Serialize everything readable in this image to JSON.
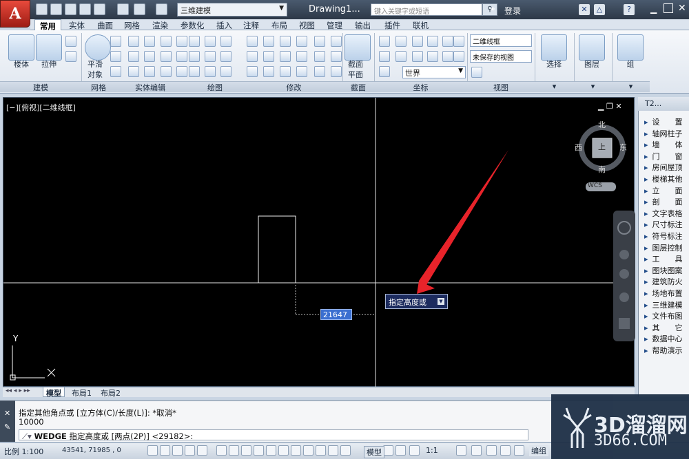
{
  "title_bar": {
    "workspace": "三维建模",
    "document_title": "Drawing1...",
    "search_placeholder": "键入关键字或短语",
    "login": "登录"
  },
  "ribbon_tabs": [
    "常用",
    "实体",
    "曲面",
    "网格",
    "渲染",
    "参数化",
    "插入",
    "注释",
    "布局",
    "视图",
    "管理",
    "输出",
    "插件",
    "联机"
  ],
  "active_tab": "常用",
  "ribbon": {
    "modeling_big": [
      "楼体",
      "拉伸"
    ],
    "smooth_label_1": "平滑",
    "smooth_label_2": "对象",
    "section_label_1": "截面",
    "section_label_2": "平面",
    "visual_style": "二维线框",
    "saved_view": "未保存的视图",
    "coord_world": "世界",
    "select_label": "选择",
    "layer_label": "图层",
    "group_label": "组",
    "groups": [
      "建模",
      "网格",
      "实体编辑",
      "绘图",
      "修改",
      "截面",
      "坐标",
      "视图"
    ]
  },
  "viewport": {
    "label": "[−][俯视][二维线框]",
    "compass": {
      "north": "北",
      "south": "南",
      "east": "东",
      "west": "西",
      "center": "上"
    },
    "wcs": "WCS",
    "tooltip": "指定高度或",
    "dim_value": "21647",
    "ucs_x": "X",
    "ucs_y": "Y"
  },
  "layout_tabs": [
    "模型",
    "布局1",
    "布局2"
  ],
  "palette": {
    "title": "T2...",
    "items": [
      "设　　置",
      "轴网柱子",
      "墙　　体",
      "门　　窗",
      "房间屋顶",
      "楼梯其他",
      "立　　面",
      "剖　　面",
      "文字表格",
      "尺寸标注",
      "符号标注",
      "图层控制",
      "工　　具",
      "图块图案",
      "建筑防火",
      "场地布置",
      "三维建模",
      "文件布图",
      "其　　它",
      "数据中心",
      "帮助演示"
    ]
  },
  "command": {
    "history_1": "指定其他角点或 [立方体(C)/长度(L)]: *取消*",
    "history_2": "10000",
    "prompt_cmd": "WEDGE",
    "prompt_text": "指定高度或 [两点(2P)] <29182>:"
  },
  "status_bar": {
    "scale": "比例 1:100",
    "coords": "43541, 71985 , 0",
    "model": "模型",
    "anno_scale": "1:1",
    "workspace_short": "编组"
  },
  "watermark": {
    "line1": "3D溜溜网",
    "line2": "3D66.COM"
  }
}
